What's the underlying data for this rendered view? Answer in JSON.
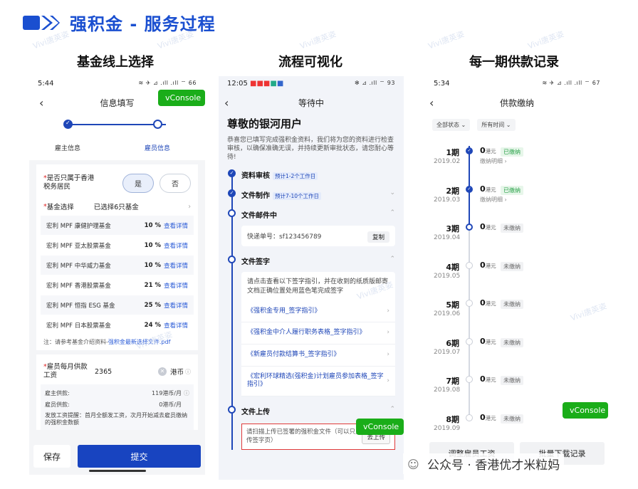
{
  "header": {
    "title": "强积金 - 服务过程"
  },
  "sections": [
    "基金线上选择",
    "流程可视化",
    "每一期供款记录"
  ],
  "watermark": "Vivi唐英姿",
  "phone1": {
    "time": "5:44",
    "status_right": "≋ ✈ ⊿ .ıll .ıll ⌔ 66",
    "title": "信息填写",
    "vconsole": "vConsole",
    "steps": [
      "雇主信息",
      "雇员信息"
    ],
    "resident_label": "是否只属于香港税务居民",
    "yes": "是",
    "no": "否",
    "fund_select_label": "基金选择",
    "fund_select_value": "已选择6只基金",
    "funds": [
      {
        "name": "宏利 MPF 康健护理基金",
        "pct": "10 %",
        "link": "查看详情"
      },
      {
        "name": "宏利 MPF 亚太股票基金",
        "pct": "10 %",
        "link": "查看详情"
      },
      {
        "name": "宏利 MPF 中华威力基金",
        "pct": "10 %",
        "link": "查看详情"
      },
      {
        "name": "宏利 MPF 香港股票基金",
        "pct": "21 %",
        "link": "查看详情"
      },
      {
        "name": "宏利 MPF 恒指 ESG 基金",
        "pct": "25 %",
        "link": "查看详情"
      },
      {
        "name": "宏利 MPF 日本股票基金",
        "pct": "24 %",
        "link": "查看详情"
      }
    ],
    "note_prefix": "注：请参考基金介绍资料-",
    "note_link": "强积金最新选择文件.pdf",
    "salary_label": "雇员每月供款工资",
    "salary_value": "2365",
    "salary_unit": "港币",
    "employer_contrib_label": "雇主供款:",
    "employer_contrib_value": "119港币/月",
    "employee_contrib_label": "雇员供款:",
    "employee_contrib_value": "0港币/月",
    "payroll_note": "发放工资提醒：首月全额发工资，次月开始减去雇员缴纳的强积金数额",
    "save": "保存",
    "submit": "提交"
  },
  "phone2": {
    "time": "12:05",
    "status_right": "✻ ⊿ .ıll ⌔ 93",
    "title": "等待中",
    "greeting": "尊敬的银河用户",
    "intro": "恭喜您已填写完成强积金资料，我们将为您的资料进行检查审核，以确保准确无误，并持续更新审批状态，请您耐心等待!",
    "step1": "资料审核",
    "step1_badge": "预计1-2个工作日",
    "step2": "文件制作",
    "step2_badge": "预计7-10个工作日",
    "step3": "文件邮件中",
    "tracking": "快递单号：sf123456789",
    "copy": "复制",
    "step4": "文件签字",
    "sign_hint": "请点击查看以下签字指引，并在收到的纸质版邮寄文档正确位置处用蓝色笔完成签字",
    "links": [
      "《强积金专用_签字指引》",
      "《强积金中介人履行职务表格_签字指引》",
      "《新雇员付款结算书_签字指引》",
      "《宏利环球精选(强积金)计划雇员参加表格_签字指引》"
    ],
    "vconsole": "vConsole",
    "step5": "文件上传",
    "upload_hint": "请扫描上传已签署的强积金文件（可以只上传签字页）",
    "upload_btn": "去上传"
  },
  "phone3": {
    "time": "5:34",
    "status_right": "≋ ✈ ⊿ .ıll .ıll ⌔ 67",
    "title": "供款缴纳",
    "filter_status": "全部状态",
    "filter_time": "所有时间",
    "records": [
      {
        "period": "1期",
        "year": "2019.02",
        "amount": "0",
        "unit": "港元",
        "status": "已缴纳",
        "paid": true,
        "detail": "缴纳明细"
      },
      {
        "period": "2期",
        "year": "2019.03",
        "amount": "0",
        "unit": "港元",
        "status": "已缴纳",
        "paid": true,
        "detail": "缴纳明细"
      },
      {
        "period": "3期",
        "year": "2019.04",
        "amount": "0",
        "unit": "港元",
        "status": "未缴纳",
        "paid": false,
        "detail": ""
      },
      {
        "period": "4期",
        "year": "2019.05",
        "amount": "0",
        "unit": "港元",
        "status": "未缴纳",
        "paid": false,
        "detail": ""
      },
      {
        "period": "5期",
        "year": "2019.06",
        "amount": "0",
        "unit": "港元",
        "status": "未缴纳",
        "paid": false,
        "detail": ""
      },
      {
        "period": "6期",
        "year": "2019.07",
        "amount": "0",
        "unit": "港元",
        "status": "未缴纳",
        "paid": false,
        "detail": ""
      },
      {
        "period": "7期",
        "year": "2019.08",
        "amount": "0",
        "unit": "港元",
        "status": "未缴纳",
        "paid": false,
        "detail": ""
      },
      {
        "period": "8期",
        "year": "2019.09",
        "amount": "0",
        "unit": "港元",
        "status": "未缴纳",
        "paid": false,
        "detail": ""
      }
    ],
    "vconsole": "vConsole",
    "adjust_btn": "调整雇员工资",
    "download_btn": "批量下载记录"
  },
  "wechat": {
    "label": "公众号 · 香港优才米粒妈"
  }
}
